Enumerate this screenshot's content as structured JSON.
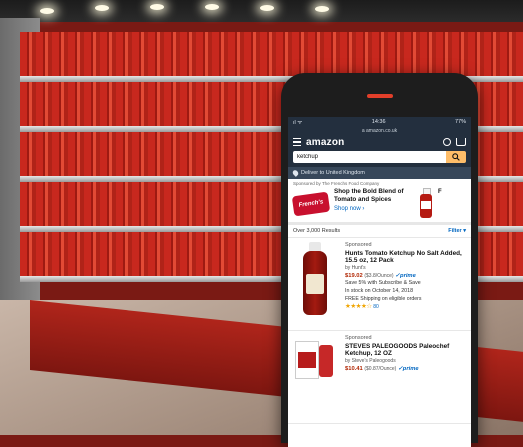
{
  "status_bar": {
    "signal": "ıl ᯤ",
    "time": "14:36",
    "battery": "77%"
  },
  "url": "a amazon.co.uk",
  "header": {
    "logo": "amazon"
  },
  "search": {
    "value": "ketchup"
  },
  "deliver": {
    "text": "Deliver to United Kingdom"
  },
  "sponsor_banner": {
    "byline": "Sponsored by The Frenchs Food Company",
    "brand": "French's",
    "headline": "Shop the Bold Blend of Tomato and Spices",
    "link": "Shop now ›",
    "cut_text": "F"
  },
  "results_bar": {
    "count": "Over 3,000 Results",
    "filter": "Filter ▾"
  },
  "products": [
    {
      "sponsored": "Sponsored",
      "title": "Hunts Tomato Ketchup No Salt Added, 15.5 oz, 12 Pack",
      "by": "by Hunt's",
      "price": "$19.02",
      "unit": "($3.8/Ounce)",
      "prime": "✓prime",
      "save": "Save 5% with Subscribe & Save",
      "stock": "In stock on October 14, 2018",
      "shipping": "FREE Shipping on eligible orders",
      "stars": "★★★★☆",
      "reviews": "80"
    },
    {
      "sponsored": "Sponsored",
      "title": "STEVES PALEOGOODS Paleochef Ketchup, 12 OZ",
      "by": "by Steve's Paleogoods",
      "price": "$10.41",
      "unit": "($0.87/Ounce)",
      "prime": "✓prime"
    }
  ],
  "colors": {
    "nav": "#232f3e",
    "search_button": "#febd69",
    "price": "#b12704",
    "link": "#0066c0",
    "shelf_red": "#c8281e"
  }
}
